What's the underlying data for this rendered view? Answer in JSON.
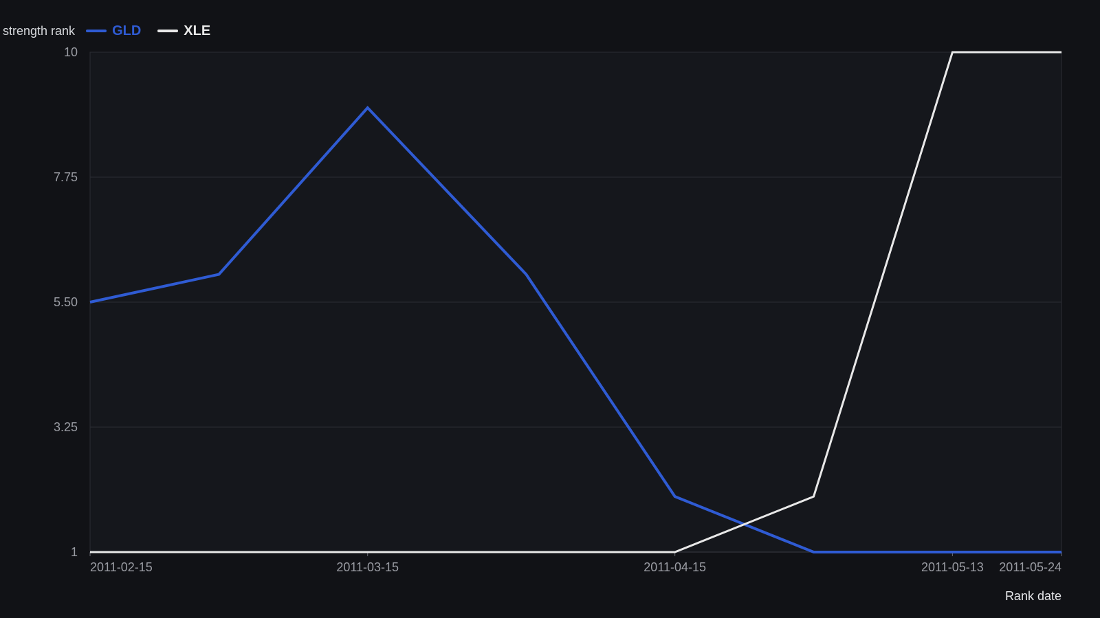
{
  "chart_data": {
    "type": "line",
    "ylabel": "strength rank",
    "xlabel": "Rank date",
    "ylim": [
      1,
      10
    ],
    "yticks": [
      "1",
      "3.25",
      "5.50",
      "7.75",
      "10"
    ],
    "xticks": [
      "2011-02-15",
      "2011-03-15",
      "2011-04-15",
      "2011-05-13",
      "2011-05-24"
    ],
    "x": [
      "2011-02-15",
      "2011-02-28",
      "2011-03-15",
      "2011-03-31",
      "2011-04-15",
      "2011-04-29",
      "2011-05-13",
      "2011-05-24"
    ],
    "series": [
      {
        "name": "GLD",
        "color": "#2f5bd3",
        "values": [
          5.5,
          6,
          9,
          6,
          2,
          1,
          1,
          1
        ]
      },
      {
        "name": "XLE",
        "color": "#e8e8e8",
        "values": [
          1,
          1,
          1,
          1,
          1,
          2,
          10,
          10
        ]
      }
    ],
    "grid": true,
    "legend_position": "top-left"
  }
}
